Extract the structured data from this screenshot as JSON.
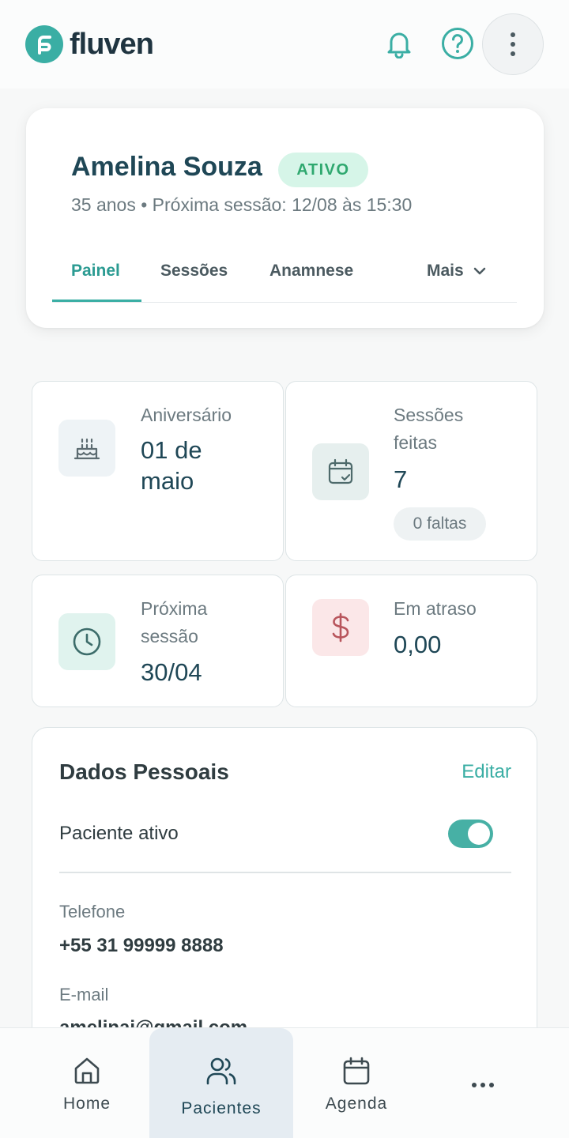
{
  "app": {
    "brand": "fluven",
    "accent": "#3aaea4"
  },
  "header": {
    "icons": [
      "bell-icon",
      "help-icon",
      "more-vertical-icon"
    ]
  },
  "patient": {
    "name": "Amelina Souza",
    "status": "ATIVO",
    "subtitle": "35 anos • Próxima sessão: 12/08 às 15:30"
  },
  "tabs": [
    {
      "label": "Painel",
      "active": true
    },
    {
      "label": "Sessões",
      "active": false
    },
    {
      "label": "Anamnese",
      "active": false
    },
    {
      "label": "Mais",
      "active": false
    }
  ],
  "stats": {
    "birthday": {
      "label": "Aniversário",
      "value_line1": "01 de",
      "value_line2": "maio",
      "icon": "cake-icon"
    },
    "sessions": {
      "label_line1": "Sessões",
      "label_line2": "feitas",
      "value": "7",
      "badge": "0 faltas",
      "icon": "calendar-check-icon"
    },
    "next": {
      "label_line1": "Próxima",
      "label_line2": "sessão",
      "value": "30/04",
      "icon": "clock-icon"
    },
    "overdue": {
      "label": "Em atraso",
      "value": "0,00",
      "icon": "dollar-icon"
    }
  },
  "personal": {
    "title": "Dados Pessoais",
    "edit_label": "Editar",
    "active_label": "Paciente ativo",
    "active": true,
    "phone_label": "Telefone",
    "phone_value": "+55 31 99999 8888",
    "email_label": "E-mail",
    "email_value": "amelinai@gmail.com"
  },
  "nav": [
    {
      "label": "Home",
      "icon": "home-icon",
      "active": false
    },
    {
      "label": "Pacientes",
      "icon": "users-icon",
      "active": true
    },
    {
      "label": "Agenda",
      "icon": "calendar-icon",
      "active": false
    },
    {
      "label": "",
      "icon": "more-horizontal-icon",
      "active": false
    }
  ]
}
